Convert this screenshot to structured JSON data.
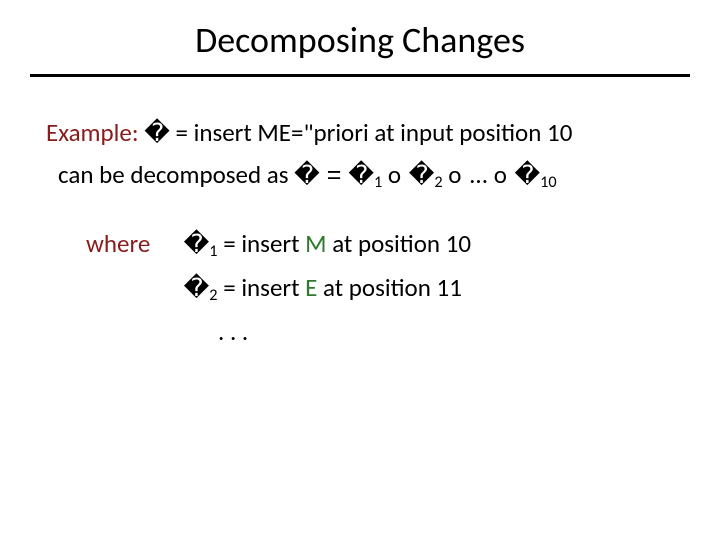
{
  "title": "Decomposing Changes",
  "example": {
    "label": "Example:",
    "text": " = insert  ME=\"priori  at input position 10"
  },
  "decompose": {
    "prefix": "can be decomposed as "
  },
  "glyph": {
    "delta": "�",
    "delta_eq": "� = ",
    "compose": " o ",
    "ellipsis": " ... ",
    "eq_tail": " = "
  },
  "sub": {
    "one": "1",
    "two": "2",
    "ten": "10"
  },
  "where": {
    "label": "where",
    "items": [
      {
        "pre": "insert ",
        "letter": "M",
        "post": " at position 10"
      },
      {
        "pre": "insert ",
        "letter": "E",
        "post": " at position 11"
      }
    ],
    "dots": ". . ."
  }
}
